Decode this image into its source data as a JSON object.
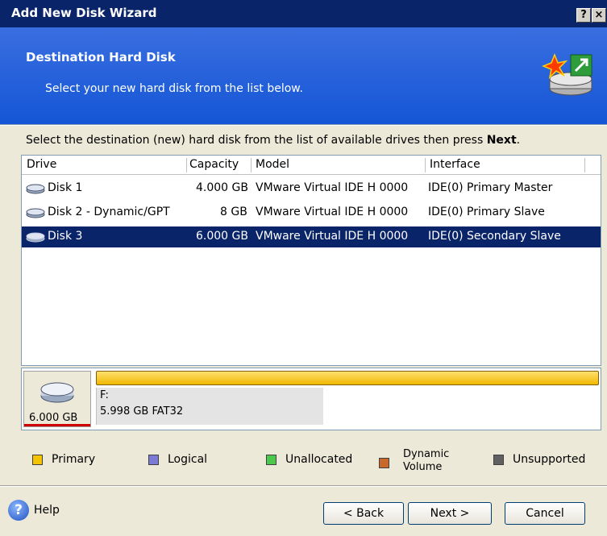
{
  "window": {
    "title": "Add New Disk Wizard",
    "help_button": "?",
    "close_button": "×"
  },
  "header": {
    "title": "Destination Hard Disk",
    "subtitle": "Select your new hard disk from the list below."
  },
  "instruction": {
    "text": "Select the destination (new) hard disk from the list of available drives then press ",
    "bold": "Next",
    "end": "."
  },
  "list": {
    "columns": [
      "Drive",
      "Capacity",
      "Model",
      "Interface"
    ],
    "rows": [
      {
        "drive": "Disk 1",
        "capacity": "4.000 GB",
        "model": "VMware Virtual IDE H 0000",
        "interface": "IDE(0) Primary Master"
      },
      {
        "drive": "Disk 2 - Dynamic/GPT",
        "capacity": "8 GB",
        "model": "VMware Virtual IDE H 0000",
        "interface": "IDE(0) Primary Slave"
      },
      {
        "drive": "Disk 3",
        "capacity": "6.000 GB",
        "model": "VMware Virtual IDE H 0000",
        "interface": "IDE(0) Secondary Slave"
      }
    ],
    "selected_index": 2
  },
  "disk_map": {
    "capacity": "6.000 GB",
    "partition_letter": "F:",
    "partition_info": "5.998 GB  FAT32"
  },
  "legend": {
    "items": [
      {
        "label": "Primary",
        "color": "#f5c400"
      },
      {
        "label": "Logical",
        "color": "#7b7bd6"
      },
      {
        "label": "Unallocated",
        "color": "#4cc84c"
      },
      {
        "label": "Dynamic",
        "label2": "Volume",
        "color": "#c8682c"
      },
      {
        "label": "Unsupported",
        "color": "#606060"
      }
    ]
  },
  "footer": {
    "help_label": "Help",
    "back_label": "< Back",
    "next_label": "Next >",
    "cancel_label": "Cancel"
  }
}
